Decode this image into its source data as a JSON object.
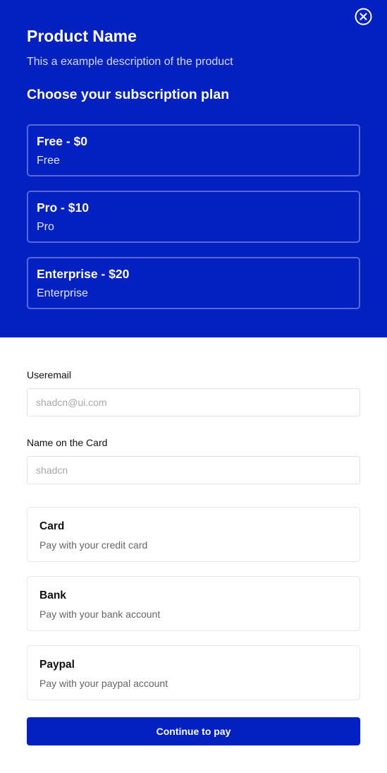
{
  "header": {
    "product_title": "Product Name",
    "product_description": "This a example description of the product",
    "plan_heading": "Choose your subscription plan",
    "close_icon": "close-circle-icon"
  },
  "plans": [
    {
      "name": "Free - $0",
      "subtitle": "Free"
    },
    {
      "name": "Pro - $10",
      "subtitle": "Pro"
    },
    {
      "name": "Enterprise - $20",
      "subtitle": "Enterprise"
    }
  ],
  "form": {
    "email_label": "Useremail",
    "email_placeholder": "shadcn@ui.com",
    "email_value": "",
    "card_name_label": "Name on the Card",
    "card_name_placeholder": "shadcn",
    "card_name_value": ""
  },
  "payment_methods": [
    {
      "name": "Card",
      "description": "Pay with your credit card"
    },
    {
      "name": "Bank",
      "description": "Pay with your bank account"
    },
    {
      "name": "Paypal",
      "description": "Pay with your paypal account"
    }
  ],
  "continue_label": "Continue to pay",
  "colors": {
    "brand": "#0321c0",
    "plan_border": "#5569d8",
    "card_border": "#e6e6e6",
    "muted_text": "#666666"
  }
}
